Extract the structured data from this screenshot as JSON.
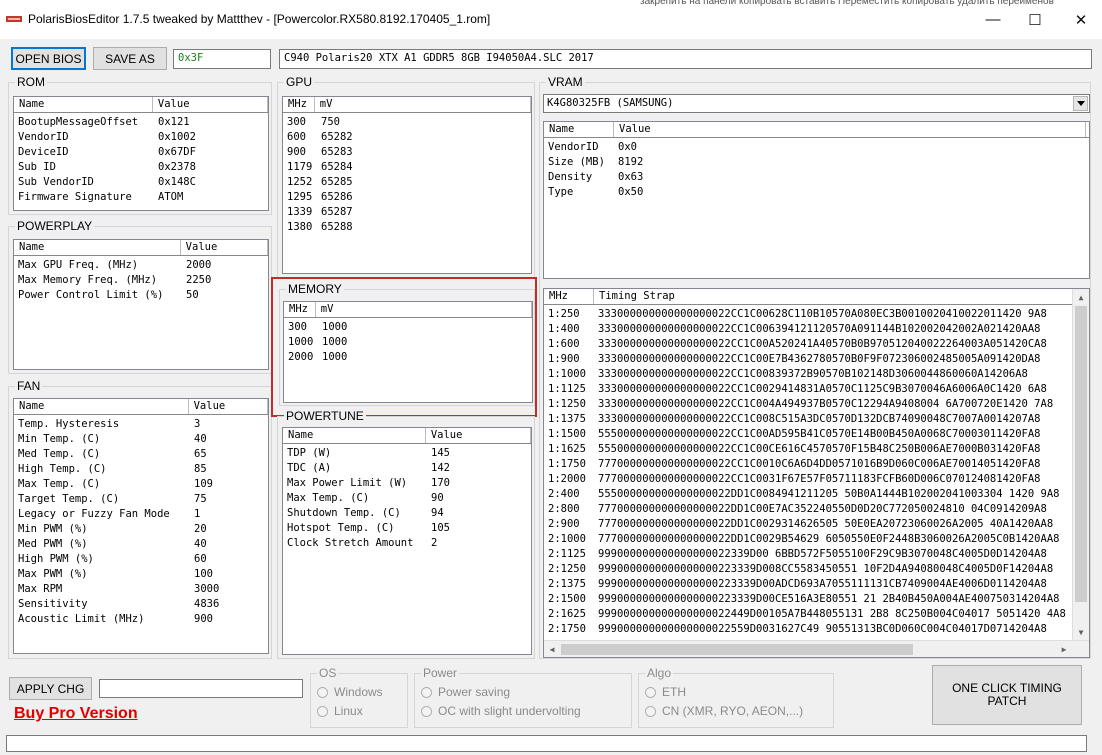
{
  "window": {
    "title": "PolarisBiosEditor 1.7.5 tweaked by Mattthev  - [Powercolor.RX580.8192.170405_1.rom]",
    "background_text": "закрепить на панели  копировать  вставить                                     Переместить  копировать    удалить  переименов",
    "minimize_glyph": "—",
    "maximize_glyph": "☐",
    "close_glyph": "✕"
  },
  "toolbar": {
    "open_label": "OPEN BIOS",
    "save_label": "SAVE AS",
    "checksum_value": "0x3F",
    "bios_info_value": "C940 Polaris20 XTX A1 GDDR5 8GB I94050A4.SLC 2017"
  },
  "rom": {
    "title": "ROM",
    "headers": [
      "Name",
      "Value"
    ],
    "rows": [
      [
        "BootupMessageOffset",
        "0x121"
      ],
      [
        "VendorID",
        "0x1002"
      ],
      [
        "DeviceID",
        "0x67DF"
      ],
      [
        "Sub ID",
        "0x2378"
      ],
      [
        "Sub VendorID",
        "0x148C"
      ],
      [
        "Firmware Signature",
        "ATOM"
      ]
    ]
  },
  "powerplay": {
    "title": "POWERPLAY",
    "headers": [
      "Name",
      "Value"
    ],
    "rows": [
      [
        "Max GPU Freq. (MHz)",
        "2000"
      ],
      [
        "Max Memory Freq. (MHz)",
        "2250"
      ],
      [
        "Power Control Limit (%)",
        "50"
      ]
    ]
  },
  "fan": {
    "title": "FAN",
    "headers": [
      "Name",
      "Value"
    ],
    "rows": [
      [
        "Temp. Hysteresis",
        "3"
      ],
      [
        "Min Temp. (C)",
        "40"
      ],
      [
        "Med Temp. (C)",
        "65"
      ],
      [
        "High Temp. (C)",
        "85"
      ],
      [
        "Max Temp. (C)",
        "109"
      ],
      [
        "Target Temp. (C)",
        "75"
      ],
      [
        "Legacy or Fuzzy Fan Mode",
        "1"
      ],
      [
        "Min PWM (%)",
        "20"
      ],
      [
        "Med PWM (%)",
        "40"
      ],
      [
        "High PWM (%)",
        "60"
      ],
      [
        "Max PWM (%)",
        "100"
      ],
      [
        "Max RPM",
        "3000"
      ],
      [
        "Sensitivity",
        "4836"
      ],
      [
        "Acoustic Limit (MHz)",
        "900"
      ]
    ]
  },
  "gpu": {
    "title": "GPU",
    "headers": [
      "MHz",
      "mV"
    ],
    "rows": [
      [
        "300",
        "750"
      ],
      [
        "600",
        "65282"
      ],
      [
        "900",
        "65283"
      ],
      [
        "1179",
        "65284"
      ],
      [
        "1252",
        "65285"
      ],
      [
        "1295",
        "65286"
      ],
      [
        "1339",
        "65287"
      ],
      [
        "1380",
        "65288"
      ]
    ]
  },
  "memory": {
    "title": "MEMORY",
    "headers": [
      "MHz",
      "mV"
    ],
    "rows": [
      [
        "300",
        "1000"
      ],
      [
        "1000",
        "1000"
      ],
      [
        "2000",
        "1000"
      ]
    ],
    "highlight_color": "#c42b2b"
  },
  "powertune": {
    "title": "POWERTUNE",
    "headers": [
      "Name",
      "Value"
    ],
    "rows": [
      [
        "TDP (W)",
        "145"
      ],
      [
        "TDC (A)",
        "142"
      ],
      [
        "Max Power Limit (W)",
        "170"
      ],
      [
        "Max Temp. (C)",
        "90"
      ],
      [
        "Shutdown Temp. (C)",
        "94"
      ],
      [
        "Hotspot Temp. (C)",
        "105"
      ],
      [
        "Clock Stretch Amount",
        "2"
      ]
    ]
  },
  "vram": {
    "title": "VRAM",
    "selected_chip": "K4G80325FB (SAMSUNG)",
    "headers": [
      "Name",
      "Value"
    ],
    "rows": [
      [
        "VendorID",
        "0x0"
      ],
      [
        "Size (MB)",
        "8192"
      ],
      [
        "Density",
        "0x63"
      ],
      [
        "Type",
        "0x50"
      ]
    ]
  },
  "timing": {
    "headers": [
      "MHz",
      "Timing Strap"
    ],
    "rows": [
      [
        "1:250",
        "333000000000000000022CC1C00628C110B10570A080EC3B0010020410022011420 9A8"
      ],
      [
        "1:400",
        "333000000000000000022CC1C006394121120570A091144B102002042002A021420AA8"
      ],
      [
        "1:600",
        "333000000000000000022CC1C00A520241A40570B0B970512040022264003A051420CA8"
      ],
      [
        "1:900",
        "333000000000000000022CC1C00E7B4362780570B0F9F072306002485005A091420DA8"
      ],
      [
        "1:1000",
        "333000000000000000022CC1C00839372B90570B102148D3060044860060A14206A8"
      ],
      [
        "1:1125",
        "333000000000000000022CC1C0029414831A0570C1125C9B3070046A6006A0C1420 6A8"
      ],
      [
        "1:1250",
        "333000000000000000022CC1C004A494937B0570C12294A9408004 6A700720E1420 7A8"
      ],
      [
        "1:1375",
        "333000000000000000022CC1C008C515A3DC0570D132DCB74090048C7007A0014207A8"
      ],
      [
        "1:1500",
        "555000000000000000022CC1C00AD595B41C0570E14B00B450A0068C70003011420FA8"
      ],
      [
        "1:1625",
        "555000000000000000022CC1C00CE616C4570570F15B48C250B006AE7000B031420FA8"
      ],
      [
        "1:1750",
        "777000000000000000022CC1C0010C6A6D4DD0571016B9D060C006AE70014051420FA8"
      ],
      [
        "1:2000",
        "777000000000000000022CC1C0031F67E57F05711183FCFB60D006C070124081420FA8"
      ],
      [
        "2:400",
        "555000000000000000022DD1C0084941211205 50B0A1444B102002041003304 1420 9A8"
      ],
      [
        "2:800",
        "777000000000000000022DD1C00E7AC352240550D0D20C772050024810 04C0914209A8"
      ],
      [
        "2:900",
        "777000000000000000022DD1C0029314626505 50E0EA20723060026A2005 40A1420AA8"
      ],
      [
        "2:1000",
        "777000000000000000022DD1C0029B54629 6050550E0F2448B3060026A2005C0B1420AA8"
      ],
      [
        "2:1125",
        "999000000000000000022339D00 6BBD572F5055100F29C9B3070048C4005D0D14204A8"
      ],
      [
        "2:1250",
        "9990000000000000000223339D008CC5583450551 10F2D4A94080048C4005D0F14204A8"
      ],
      [
        "2:1375",
        "9990000000000000000223339D00ADCD693A7055111131CB7409004AE4006D0114204A8"
      ],
      [
        "2:1500",
        "9990000000000000000223339D00CE516A3E80551 21 2B40B450A004AE400750314204A8"
      ],
      [
        "2:1625",
        "999000000000000000022449D00105A7B448055131 2B8 8C250B004C04017 5051420 4A8"
      ],
      [
        "2:1750",
        "999000000000000000022559D0031627C49 90551313BC0D060C004C04017D0714204A8"
      ]
    ]
  },
  "bottom": {
    "apply_label": "APPLY CHG",
    "apply_field_value": "",
    "pro_link": "Buy Pro Version",
    "os_title": "OS",
    "os_options": [
      "Windows",
      "Linux"
    ],
    "power_title": "Power",
    "power_options": [
      "Power saving",
      "OC with slight undervolting"
    ],
    "algo_title": "Algo",
    "algo_options": [
      "ETH",
      "CN (XMR, RYO, AEON,...)"
    ],
    "timing_patch_label": "ONE CLICK TIMING\nPATCH",
    "status_text": ""
  }
}
